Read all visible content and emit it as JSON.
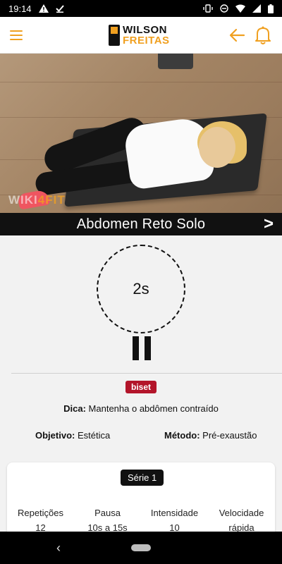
{
  "status": {
    "time": "19:14",
    "icons": [
      "warning-icon",
      "download-check-icon",
      "vibrate-icon",
      "dnd-icon",
      "wifi-icon",
      "signal-icon",
      "battery-icon"
    ]
  },
  "header": {
    "logo_line1": "WILSON",
    "logo_line2": "FREITAS",
    "accent": "#f0a020"
  },
  "video": {
    "watermark_a": "WIKI",
    "watermark_b": "4FIT"
  },
  "exercise": {
    "title": "Abdomen Reto Solo",
    "next": ">"
  },
  "timer": {
    "value": "2s"
  },
  "badge": "biset",
  "tip": {
    "label": "Dica:",
    "text": "Mantenha o abdômen contraído"
  },
  "objetivo": {
    "label": "Objetivo:",
    "value": "Estética"
  },
  "metodo": {
    "label": "Método:",
    "value": "Pré-exaustão"
  },
  "card": {
    "serie": "Série 1",
    "stats": [
      {
        "label": "Repetições",
        "value": "12"
      },
      {
        "label": "Pausa",
        "value": "10s a 15s"
      },
      {
        "label": "Intensidade",
        "value": "10"
      },
      {
        "label": "Velocidade",
        "value": "rápida"
      }
    ]
  },
  "nav": {
    "back": "‹"
  }
}
